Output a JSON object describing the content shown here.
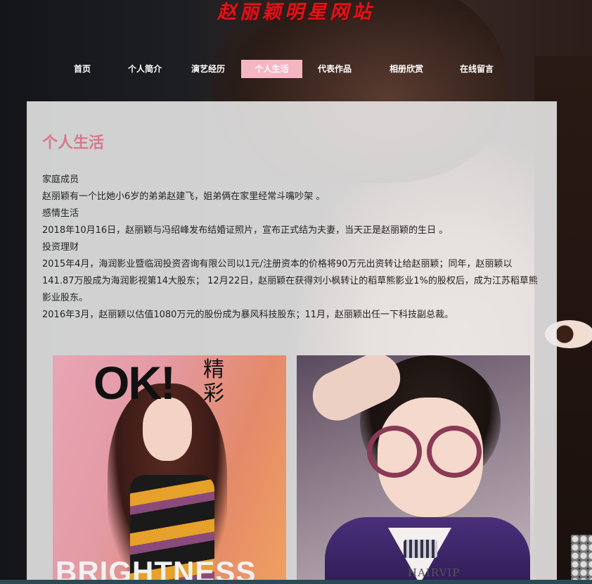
{
  "site": {
    "title": "赵丽颖明星网站"
  },
  "nav": {
    "items": [
      {
        "label": "首页"
      },
      {
        "label": "个人简介"
      },
      {
        "label": "演艺经历"
      },
      {
        "label": "个人生活",
        "active": true
      },
      {
        "label": "代表作品"
      },
      {
        "label": "相册欣赏"
      },
      {
        "label": "在线留言"
      }
    ]
  },
  "main": {
    "title": "个人生活",
    "paragraphs": [
      "家庭成员",
      "赵丽颖有一个比她小6岁的弟弟赵建飞，姐弟俩在家里经常斗嘴吵架 。",
      "感情生活",
      "2018年10月16日，赵丽颖与冯绍峰发布结婚证照片，宣布正式结为夫妻，当天正是赵丽颖的生日 。",
      "投资理财",
      "2015年4月，海润影业暨临润投资咨询有限公司以1元/注册资本的价格将90万元出资转让给赵丽颖；同年，赵丽颖以141.87万股成为海润影视第14大股东； 12月22日，赵丽颖在获得刘小枫转让的稻草熊影业1%的股权后，成为江苏稻草熊影业股东。",
      "2016年3月，赵丽颖以估值1080万元的股份成为暴风科技股东；11月，赵丽颖出任一下科技副总裁。"
    ],
    "photos": {
      "magazine": {
        "logo": "OK!",
        "logo_cn": "精彩",
        "headline": "BRIGHTNESS"
      },
      "selfie": {
        "watermark": "HAIRVIP"
      }
    }
  },
  "colors": {
    "title_red": "#e0141c",
    "active_tab": "#f3b6c2",
    "heading_pink": "#d9778d"
  }
}
